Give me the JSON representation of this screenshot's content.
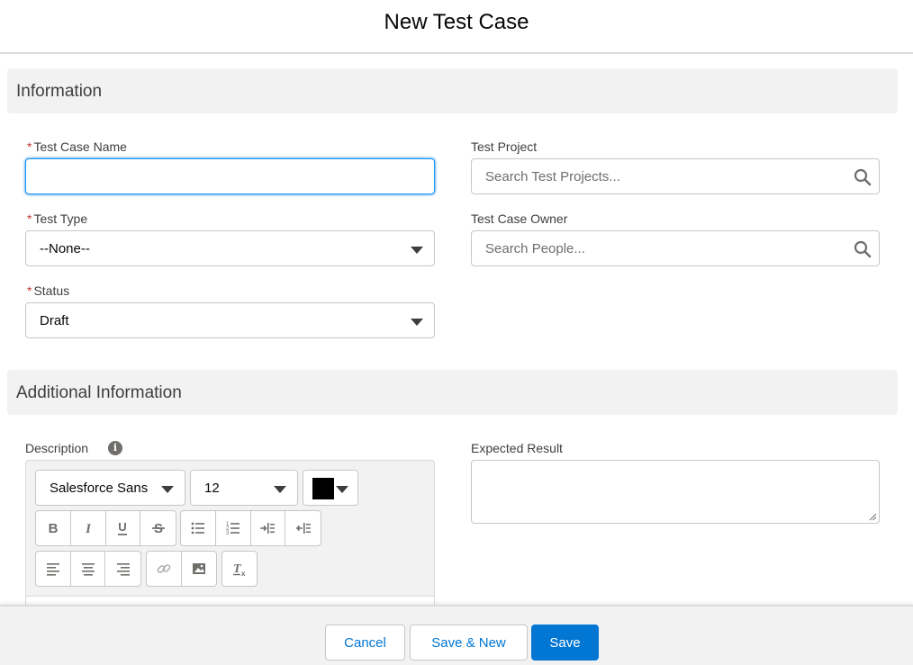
{
  "modal": {
    "title": "New Test Case"
  },
  "sections": {
    "information": "Information",
    "additional": "Additional Information"
  },
  "fields": {
    "test_case_name": {
      "label": "Test Case Name",
      "required": "*",
      "value": ""
    },
    "test_project": {
      "label": "Test Project",
      "placeholder": "Search Test Projects..."
    },
    "test_type": {
      "label": "Test Type",
      "required": "*",
      "value": "--None--"
    },
    "test_case_owner": {
      "label": "Test Case Owner",
      "placeholder": "Search People..."
    },
    "status": {
      "label": "Status",
      "required": "*",
      "value": "Draft"
    },
    "description": {
      "label": "Description",
      "info_icon": "i"
    },
    "expected_result": {
      "label": "Expected Result",
      "value": ""
    }
  },
  "editor": {
    "font_family": "Salesforce Sans",
    "font_size": "12",
    "text_color": "#000000"
  },
  "footer": {
    "cancel": "Cancel",
    "save_new": "Save & New",
    "save": "Save"
  },
  "colors": {
    "brand": "#0176d3",
    "required": "#c23934",
    "section_bg": "#f3f2f2"
  }
}
